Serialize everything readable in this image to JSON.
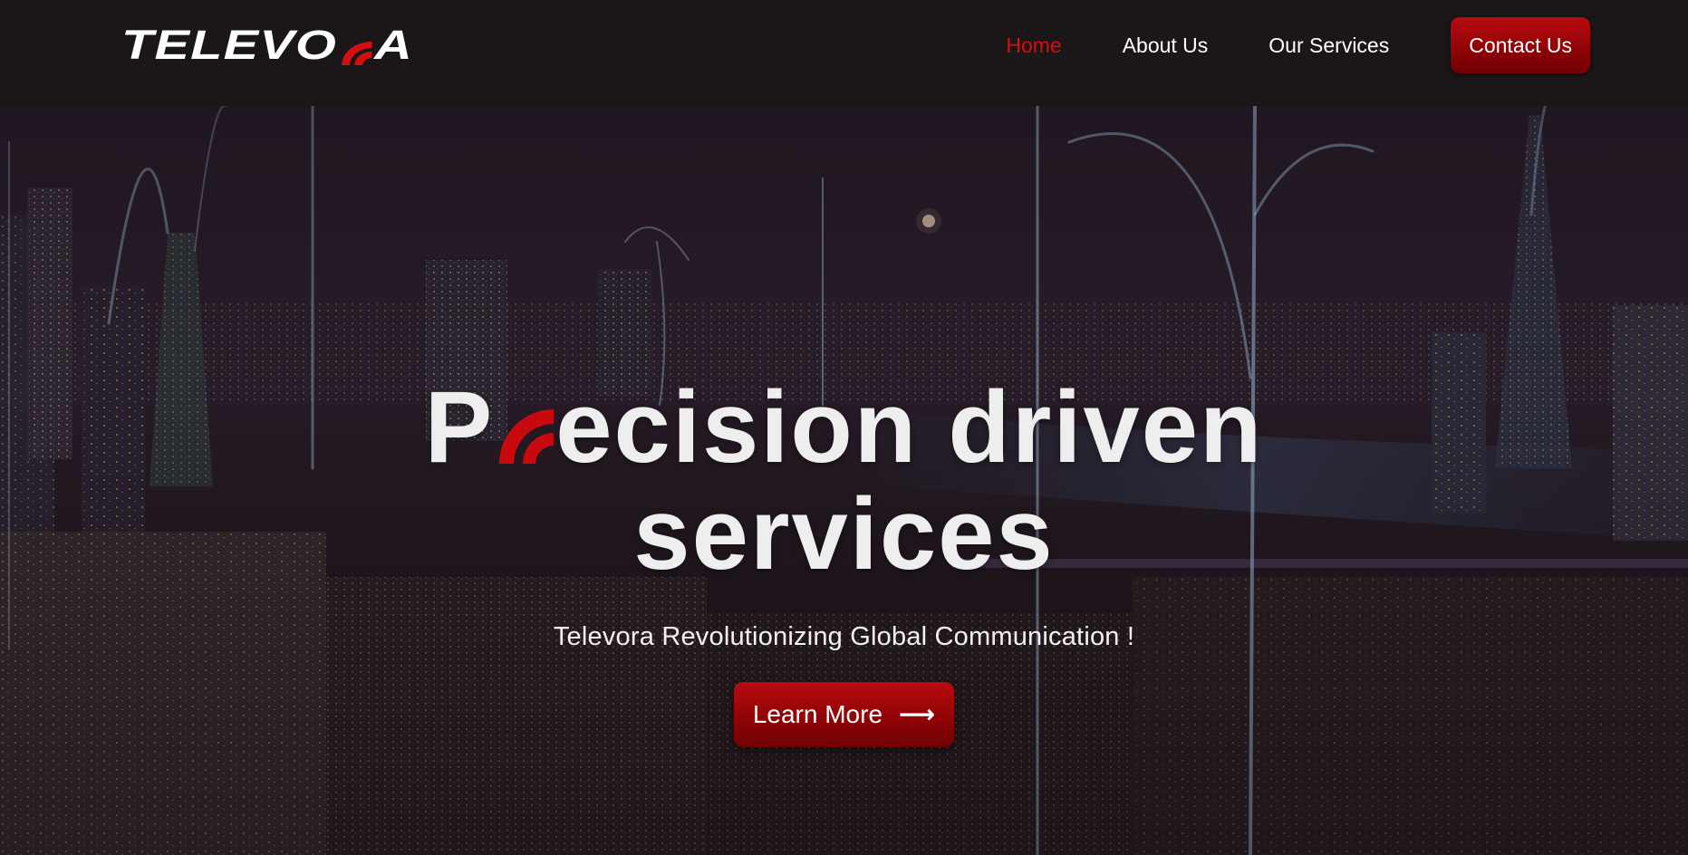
{
  "brand": {
    "logo_text_before": "TELEVO",
    "logo_text_after": "A",
    "accent_color": "#d30f14",
    "button_color": "#9a0508",
    "nav_bg": "#1b1617"
  },
  "nav": {
    "links": [
      {
        "label": "Home",
        "active": true
      },
      {
        "label": "About Us",
        "active": false
      },
      {
        "label": "Our Services",
        "active": false
      }
    ],
    "cta_label": "Contact Us"
  },
  "hero": {
    "title_line1_before": "P",
    "title_line1_after": "ecision driven",
    "title_line2": "services",
    "subtitle": "Televora Revolutionizing Global Communication !",
    "button_label": "Learn More",
    "button_icon": "arrow-right-icon"
  }
}
